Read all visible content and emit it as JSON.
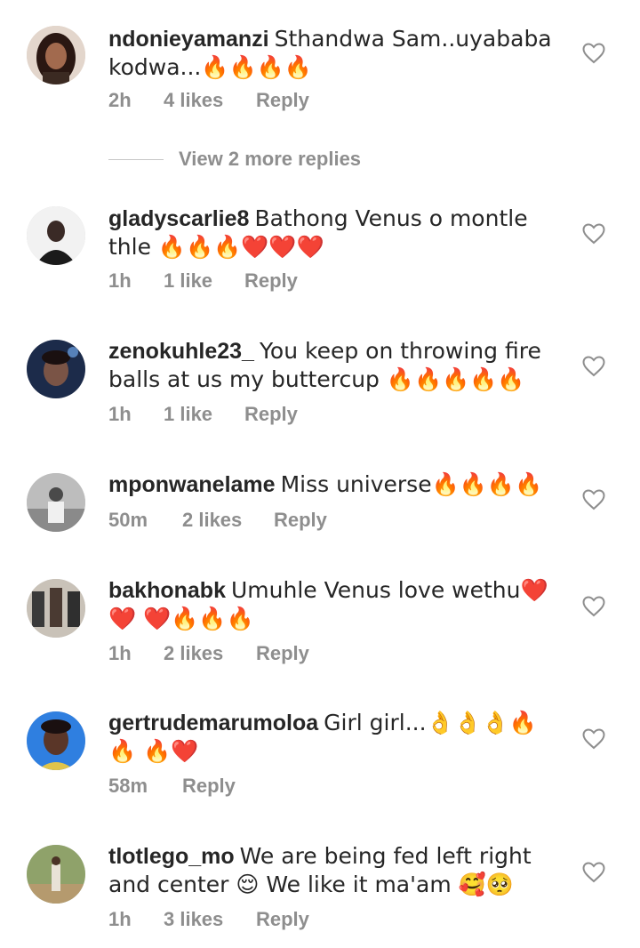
{
  "comments": [
    {
      "username": "ndonieyamanzi",
      "text": "Sthandwa Sam..uyababa kodwa...🔥🔥🔥🔥",
      "time": "2h",
      "likes": "4 likes",
      "reply": "Reply",
      "avatar": "avatar-woman-dark-hair"
    },
    {
      "username": "gladyscarlie8",
      "text": "Bathong Venus o montle thle 🔥🔥🔥❤️❤️❤️",
      "time": "1h",
      "likes": "1 like",
      "reply": "Reply",
      "avatar": "avatar-person-portrait"
    },
    {
      "username": "zenokuhle23_",
      "text": "You keep on throwing fire balls at us my buttercup 🔥🔥🔥🔥🔥",
      "time": "1h",
      "likes": "1 like",
      "reply": "Reply",
      "avatar": "avatar-woman-blue-light"
    },
    {
      "username": "mponwanelame",
      "text": "Miss universe🔥🔥🔥🔥",
      "time": "50m",
      "likes": "2 likes",
      "reply": "Reply",
      "avatar": "avatar-grayscale-person"
    },
    {
      "username": "bakhonabk",
      "text": "Umuhle Venus love wethu❤️❤️ ❤️🔥🔥🔥",
      "time": "1h",
      "likes": "2 likes",
      "reply": "Reply",
      "avatar": "avatar-group-photo"
    },
    {
      "username": "gertrudemarumoloa",
      "text": "Girl girl...👌👌👌🔥🔥 🔥❤️",
      "time": "58m",
      "likes": "",
      "reply": "Reply",
      "avatar": "avatar-woman-blue-background"
    },
    {
      "username": "tlotlego_mo",
      "text": "We are being fed left right and center 😌 We like it ma'am 🥰🥺",
      "time": "1h",
      "likes": "3 likes",
      "reply": "Reply",
      "avatar": "avatar-outdoor-person"
    }
  ],
  "view_replies": "View 2 more replies",
  "colors": {
    "text": "#262626",
    "meta": "#8e8e8e",
    "divider": "#c7c7c7"
  },
  "icons": [
    "heart-outline-icon"
  ]
}
